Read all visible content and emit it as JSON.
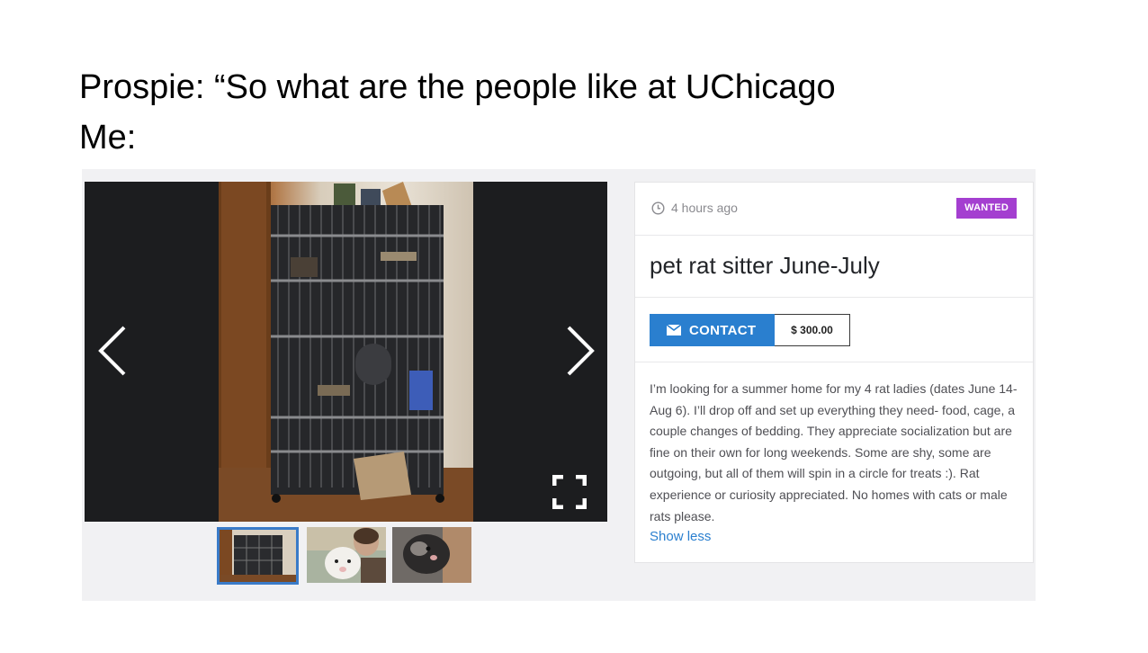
{
  "meme": {
    "line1": "Prospie: “So what are the people like at UChicago",
    "line2": "Me:"
  },
  "gallery": {
    "prev_icon": "chevron-left-icon",
    "next_icon": "chevron-right-icon",
    "fullscreen_icon": "fullscreen-icon",
    "main_photo": "rat-cage-photo",
    "thumbnails": [
      {
        "name": "cage-thumbnail",
        "selected": true
      },
      {
        "name": "white-rat-thumbnail",
        "selected": false
      },
      {
        "name": "dark-rat-thumbnail",
        "selected": false
      }
    ],
    "selected_border_color": "#3a7bc8"
  },
  "listing": {
    "posted": "4 hours ago",
    "badge": "WANTED",
    "badge_color": "#a43fd0",
    "title": "pet rat sitter June-July",
    "contact_label": "CONTACT",
    "price": "$ 300.00",
    "description": "I’m looking for a summer home for my 4 rat ladies (dates June 14-Aug 6). I’ll drop off and set up everything they need- food, cage, a couple changes of bedding. They appreciate socialization but are fine on their own for long weekends. Some are shy, some are outgoing, but all of them will spin in a circle for treats :). Rat experience or curiosity appreciated. No homes with cats or male rats please.",
    "show_less": "Show less",
    "accent_color": "#2a7fcf"
  }
}
